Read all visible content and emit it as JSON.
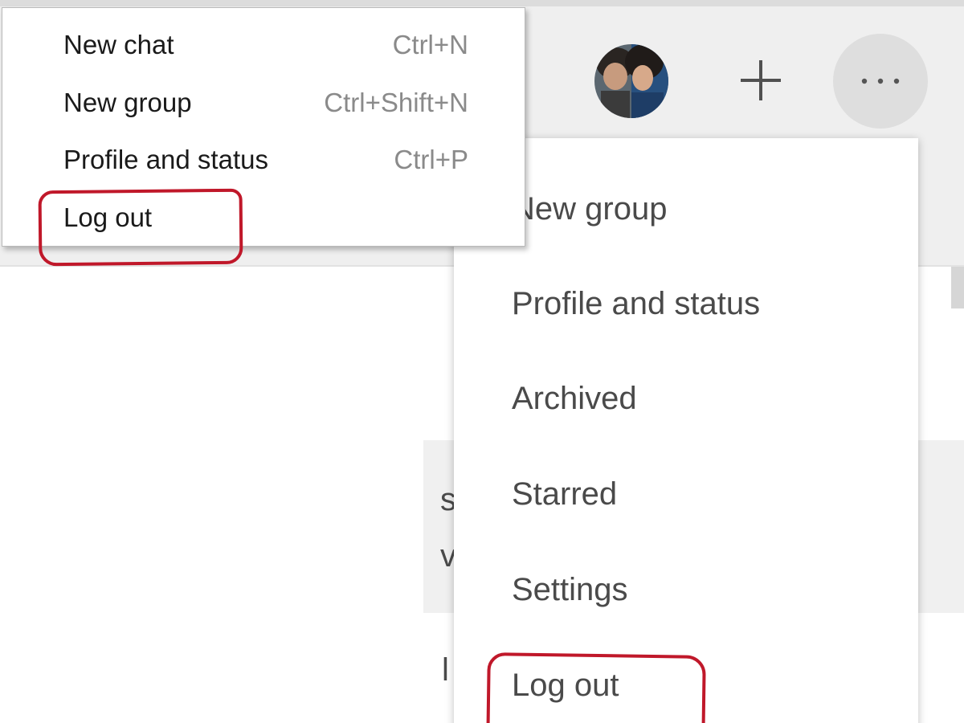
{
  "desktop_menu": {
    "items": [
      {
        "label": "New chat",
        "shortcut": "Ctrl+N"
      },
      {
        "label": "New group",
        "shortcut": "Ctrl+Shift+N"
      },
      {
        "label": "Profile and status",
        "shortcut": "Ctrl+P"
      },
      {
        "label": "Log out",
        "shortcut": ""
      }
    ]
  },
  "web_menu": {
    "items": [
      {
        "label": "New group"
      },
      {
        "label": "Profile and status"
      },
      {
        "label": "Archived"
      },
      {
        "label": "Starred"
      },
      {
        "label": "Settings"
      },
      {
        "label": "Log out"
      }
    ]
  },
  "header": {
    "icons": [
      "avatar",
      "plus-icon",
      "more-options-icon"
    ]
  },
  "background_fragments": {
    "a": "s",
    "b": "v",
    "c": "l"
  },
  "colors": {
    "annotation": "#c0182a",
    "menu_text": "#4a4a4a",
    "shortcut_text": "#8a8a8a",
    "header_bg": "#efefef",
    "menu_button_bg": "#dedede"
  }
}
